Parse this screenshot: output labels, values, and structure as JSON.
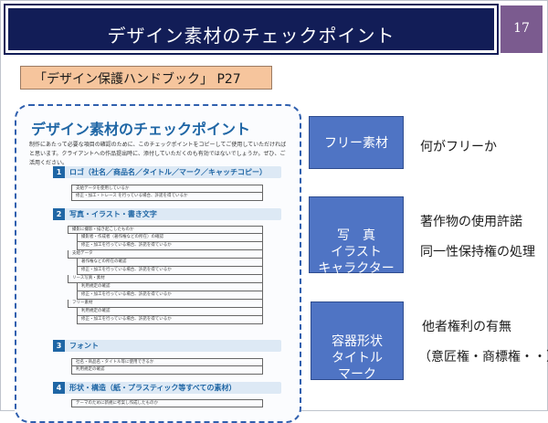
{
  "slide": {
    "title": "デザイン素材のチェックポイント",
    "page_number": "17",
    "reference": "「デザイン保護ハンドブック」 P27"
  },
  "document": {
    "title": "デザイン素材のチェックポイント",
    "intro": "制作にあたって必要な項目の確認のために、このチェックポイントをコピーしてご使用していただければと思います。クライアントへの作品提出時に、添付していただくのも有効ではないでしょうか。ぜひ、ご活用ください。",
    "sections": [
      {
        "num": "1",
        "label": "ロゴ（社名／商品名／タイトル／マーク／キャッチコピー）"
      },
      {
        "num": "2",
        "label": "写真・イラスト・書き文字"
      },
      {
        "num": "3",
        "label": "フォント"
      },
      {
        "num": "4",
        "label": "形状・構造（紙・プラスティック等すべての素材）"
      }
    ],
    "rows": {
      "s1": [
        "支給データを使用しているか",
        "修正・加工・トレース を行っている場合、許諾を得ているか"
      ],
      "s2": [
        "撮影に撮影・描き起こしたものか",
        "撮影者・作成者（著作権などの所在）の確認",
        "修正・加工を行っている場合、許諾を得ているか",
        "支給データ",
        "著作権などの所在の確認",
        "修正・加工を行っている場合、許諾を得ているか",
        "リース写真・素材",
        "利用規定の確認",
        "修正・加工を行っている場合、許諾を得ているか",
        "フリー素材",
        "利用規定の確認",
        "修正・加工を行っている場合、許諾を得ているか"
      ],
      "s3": [
        "社名・商品名・タイトル等に使用できるか",
        "利用規定の確認"
      ],
      "s4": [
        "テーマのために新規に考案し作成したものか"
      ]
    }
  },
  "boxes": [
    {
      "label": "フリー素材",
      "notes": [
        "何がフリーか"
      ]
    },
    {
      "label": "写　真\nイラスト\nキャラクター",
      "notes": [
        "著作物の使用許諾",
        "同一性保持権の処理"
      ]
    },
    {
      "label": "容器形状\nタイトル\nマーク",
      "notes": [
        "他者権利の有無",
        "（意匠権・商標権・・）"
      ]
    }
  ]
}
